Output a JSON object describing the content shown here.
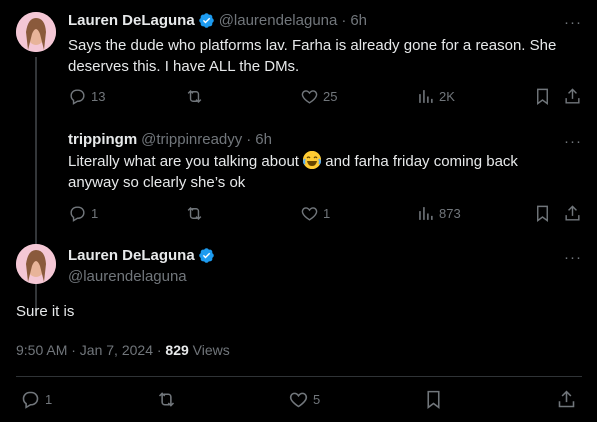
{
  "tweets": [
    {
      "name": "Lauren DeLaguna",
      "handle": "@laurendelaguna",
      "sep": "·",
      "time": "6h",
      "text": "Says the dude who platforms lav. Farha is already gone for a reason. She deserves this. I have ALL the DMs.",
      "replies": "13",
      "likes": "25",
      "views": "2K"
    },
    {
      "name": "trippingm",
      "handle": "@trippinreadyy",
      "sep": "·",
      "time": "6h",
      "text_before": "Literally what are you talking about ",
      "emoji": "face-with-tears-of-joy",
      "text_after": " and farha friday coming back anyway so clearly she’s ok",
      "replies": "1",
      "likes": "1",
      "views": "873"
    }
  ],
  "main": {
    "name": "Lauren DeLaguna",
    "handle": "@laurendelaguna",
    "text": "Sure it is",
    "timestamp": "9:50 AM · Jan 7, 2024 · ",
    "views_count": "829",
    "views_label": " Views",
    "replies": "1",
    "likes": "5"
  },
  "colors": {
    "verified": "#1d9bf0",
    "muted": "#71767b",
    "text": "#e7e9ea"
  }
}
